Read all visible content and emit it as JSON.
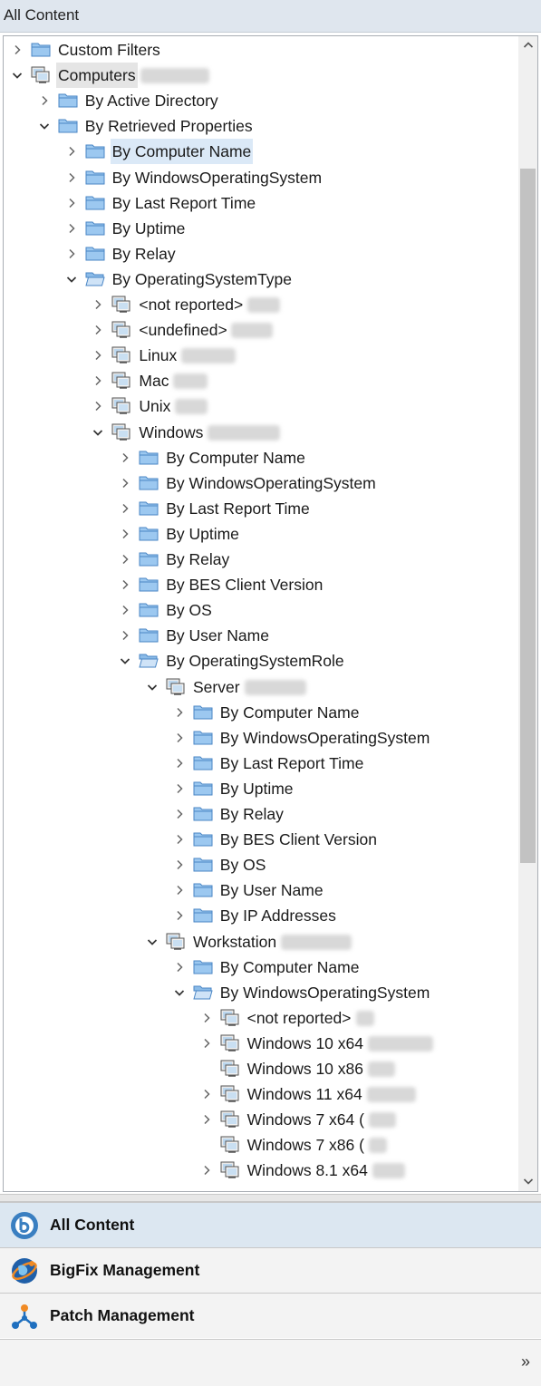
{
  "window": {
    "title": "All Content"
  },
  "tree": {
    "rows": [
      {
        "label": "Custom Filters",
        "depth": 0,
        "icon": "folder",
        "state": "collapsed"
      },
      {
        "label": "Computers",
        "depth": 0,
        "icon": "computer-group",
        "state": "expanded",
        "style": "hover",
        "blur": 76
      },
      {
        "label": "By Active Directory",
        "depth": 1,
        "icon": "folder",
        "state": "collapsed"
      },
      {
        "label": "By Retrieved Properties",
        "depth": 1,
        "icon": "folder",
        "state": "expanded"
      },
      {
        "label": "By Computer Name",
        "depth": 2,
        "icon": "folder",
        "state": "collapsed",
        "style": "selected"
      },
      {
        "label": "By WindowsOperatingSystem",
        "depth": 2,
        "icon": "folder",
        "state": "collapsed"
      },
      {
        "label": "By Last Report Time",
        "depth": 2,
        "icon": "folder",
        "state": "collapsed"
      },
      {
        "label": "By Uptime",
        "depth": 2,
        "icon": "folder",
        "state": "collapsed"
      },
      {
        "label": "By Relay",
        "depth": 2,
        "icon": "folder",
        "state": "collapsed"
      },
      {
        "label": "By OperatingSystemType",
        "depth": 2,
        "icon": "folder-open",
        "state": "expanded"
      },
      {
        "label": "<not reported>",
        "depth": 3,
        "icon": "computer-group",
        "state": "collapsed",
        "blur": 36
      },
      {
        "label": "<undefined>",
        "depth": 3,
        "icon": "computer-group",
        "state": "collapsed",
        "blur": 46
      },
      {
        "label": "Linux",
        "depth": 3,
        "icon": "computer-group",
        "state": "collapsed",
        "blur": 60
      },
      {
        "label": "Mac",
        "depth": 3,
        "icon": "computer-group",
        "state": "collapsed",
        "blur": 38
      },
      {
        "label": "Unix",
        "depth": 3,
        "icon": "computer-group",
        "state": "collapsed",
        "blur": 36
      },
      {
        "label": "Windows",
        "depth": 3,
        "icon": "computer-group",
        "state": "expanded",
        "blur": 80
      },
      {
        "label": "By Computer Name",
        "depth": 4,
        "icon": "folder",
        "state": "collapsed"
      },
      {
        "label": "By WindowsOperatingSystem",
        "depth": 4,
        "icon": "folder",
        "state": "collapsed"
      },
      {
        "label": "By Last Report Time",
        "depth": 4,
        "icon": "folder",
        "state": "collapsed"
      },
      {
        "label": "By Uptime",
        "depth": 4,
        "icon": "folder",
        "state": "collapsed"
      },
      {
        "label": "By Relay",
        "depth": 4,
        "icon": "folder",
        "state": "collapsed"
      },
      {
        "label": "By BES Client Version",
        "depth": 4,
        "icon": "folder",
        "state": "collapsed"
      },
      {
        "label": "By OS",
        "depth": 4,
        "icon": "folder",
        "state": "collapsed"
      },
      {
        "label": "By User Name",
        "depth": 4,
        "icon": "folder",
        "state": "collapsed"
      },
      {
        "label": "By OperatingSystemRole",
        "depth": 4,
        "icon": "folder-open",
        "state": "expanded"
      },
      {
        "label": "Server",
        "depth": 5,
        "icon": "computer-group",
        "state": "expanded",
        "blur": 68
      },
      {
        "label": "By Computer Name",
        "depth": 6,
        "icon": "folder",
        "state": "collapsed"
      },
      {
        "label": "By WindowsOperatingSystem",
        "depth": 6,
        "icon": "folder",
        "state": "collapsed"
      },
      {
        "label": "By Last Report Time",
        "depth": 6,
        "icon": "folder",
        "state": "collapsed"
      },
      {
        "label": "By Uptime",
        "depth": 6,
        "icon": "folder",
        "state": "collapsed"
      },
      {
        "label": "By Relay",
        "depth": 6,
        "icon": "folder",
        "state": "collapsed"
      },
      {
        "label": "By BES Client Version",
        "depth": 6,
        "icon": "folder",
        "state": "collapsed"
      },
      {
        "label": "By OS",
        "depth": 6,
        "icon": "folder",
        "state": "collapsed"
      },
      {
        "label": "By User Name",
        "depth": 6,
        "icon": "folder",
        "state": "collapsed"
      },
      {
        "label": "By IP Addresses",
        "depth": 6,
        "icon": "folder",
        "state": "collapsed"
      },
      {
        "label": "Workstation",
        "depth": 5,
        "icon": "computer-group",
        "state": "expanded",
        "blur": 78
      },
      {
        "label": "By Computer Name",
        "depth": 6,
        "icon": "folder",
        "state": "collapsed"
      },
      {
        "label": "By WindowsOperatingSystem",
        "depth": 6,
        "icon": "folder-open",
        "state": "expanded"
      },
      {
        "label": "<not reported>",
        "depth": 7,
        "icon": "computer-group",
        "state": "collapsed",
        "blur": 20
      },
      {
        "label": "Windows 10 x64",
        "depth": 7,
        "icon": "computer-group",
        "state": "collapsed",
        "blur": 72
      },
      {
        "label": "Windows 10 x86",
        "depth": 7,
        "icon": "computer-group",
        "state": "none",
        "blur": 30
      },
      {
        "label": "Windows 11 x64",
        "depth": 7,
        "icon": "computer-group",
        "state": "collapsed",
        "blur": 54
      },
      {
        "label": "Windows 7 x64 (",
        "depth": 7,
        "icon": "computer-group",
        "state": "collapsed",
        "blur": 30
      },
      {
        "label": "Windows 7 x86 (",
        "depth": 7,
        "icon": "computer-group",
        "state": "none",
        "blur": 20
      },
      {
        "label": "Windows 8.1 x64",
        "depth": 7,
        "icon": "computer-group",
        "state": "collapsed",
        "blur": 36
      }
    ]
  },
  "nav": {
    "items": [
      {
        "label": "All Content",
        "icon": "bigfix-logo-icon",
        "active": true
      },
      {
        "label": "BigFix Management",
        "icon": "globe-icon",
        "active": false
      },
      {
        "label": "Patch Management",
        "icon": "network-icon",
        "active": false
      }
    ],
    "more": "»"
  },
  "colors": {
    "selection": "#dbe9f7",
    "folder": "#5b9bd5",
    "accent": "#1e6fbf"
  }
}
